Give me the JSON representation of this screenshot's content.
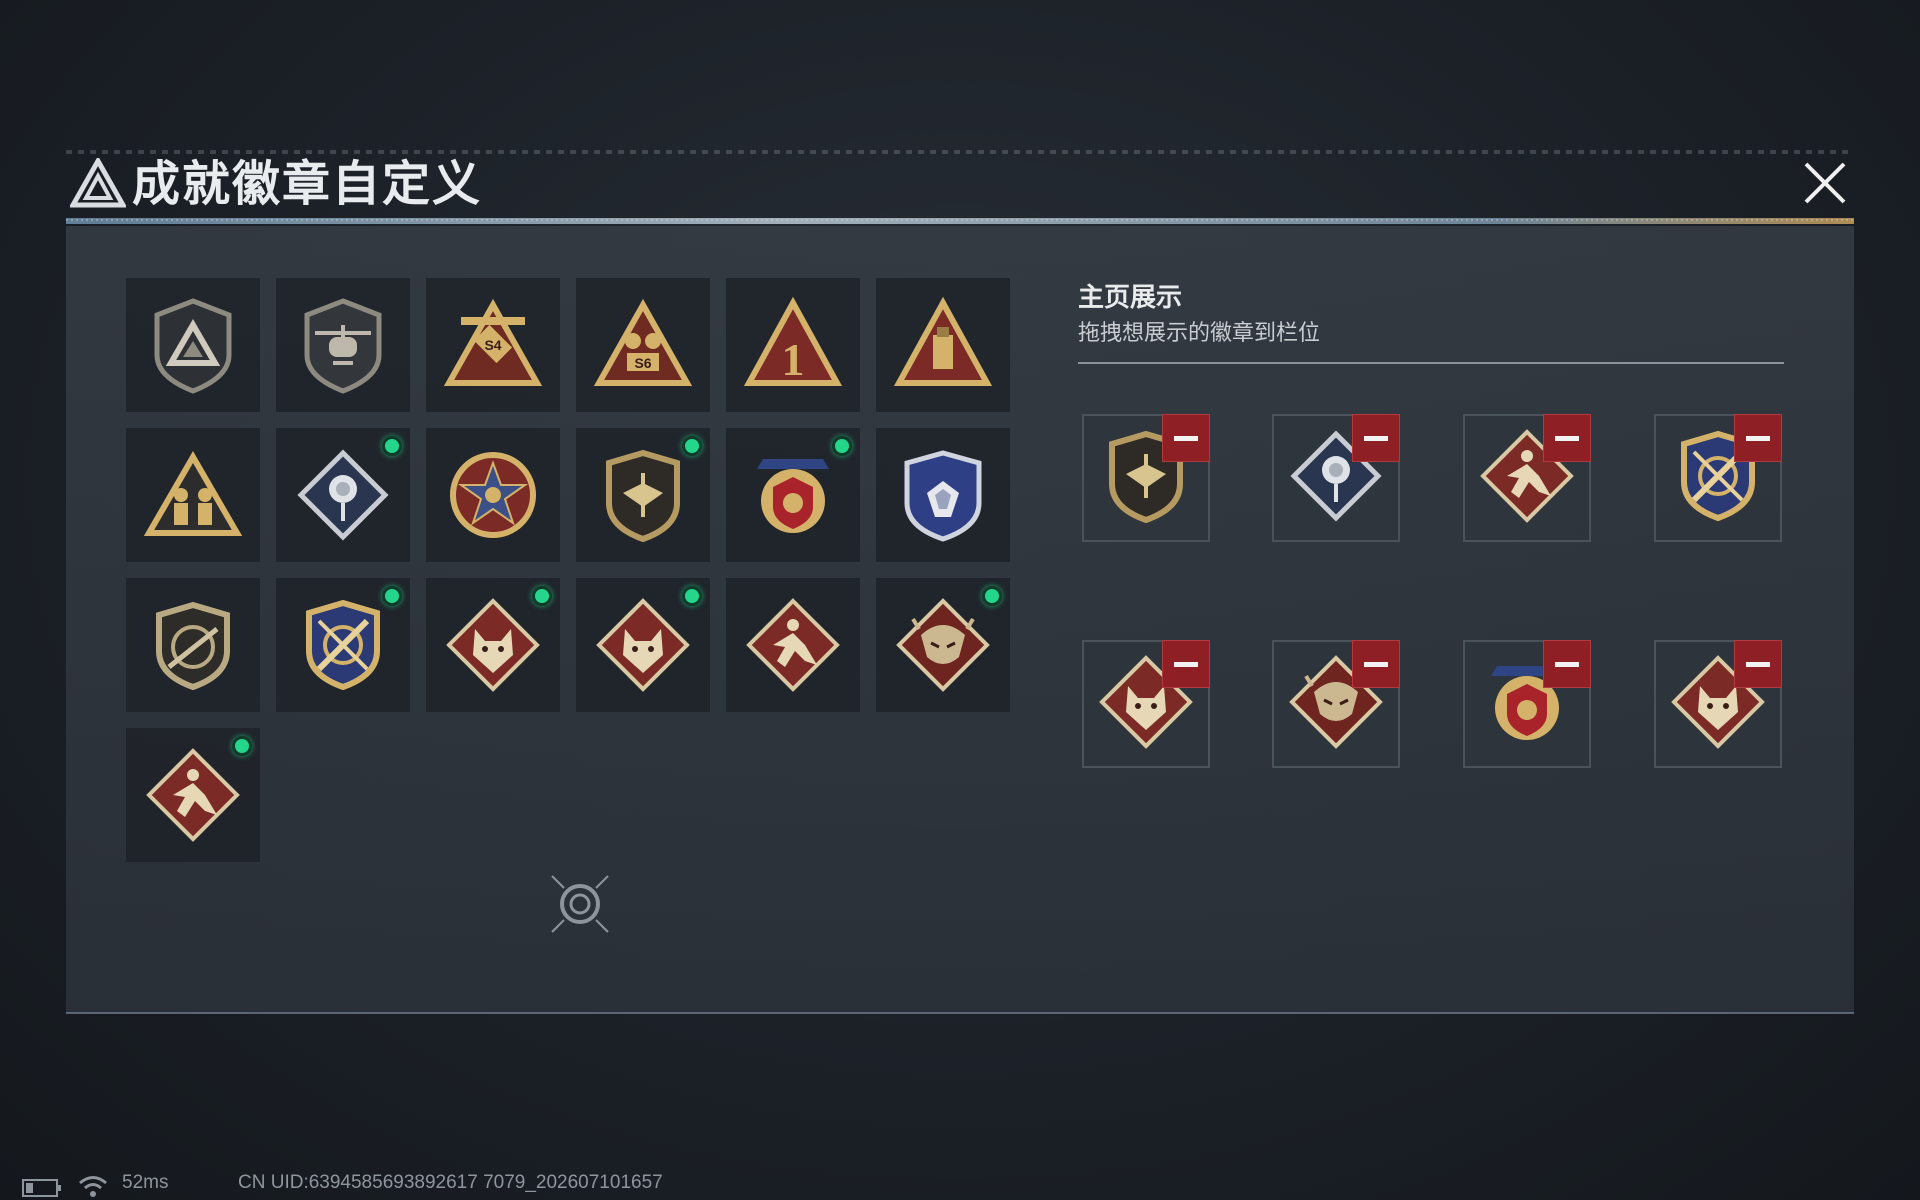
{
  "window": {
    "title": "成就徽章自定义",
    "close_icon": "close-icon"
  },
  "grid": {
    "badges": [
      {
        "icon": "triangle-shield-badge",
        "new": false
      },
      {
        "icon": "helicopter-shield-badge",
        "new": false
      },
      {
        "icon": "s4-triangle-badge",
        "new": false,
        "text": "S4"
      },
      {
        "icon": "s6-triangle-badge",
        "new": false,
        "text": "S6"
      },
      {
        "icon": "number-one-triangle-badge",
        "new": false,
        "text": "1"
      },
      {
        "icon": "usb-triangle-badge",
        "new": false
      },
      {
        "icon": "soldiers-triangle-badge",
        "new": false
      },
      {
        "icon": "rose-diamond-badge",
        "new": true
      },
      {
        "icon": "star-medal-badge",
        "new": false
      },
      {
        "icon": "bird-shield-badge",
        "new": true
      },
      {
        "icon": "laurel-star-badge",
        "new": true
      },
      {
        "icon": "diamond-blue-shield-badge",
        "new": false
      },
      {
        "icon": "rifle-shield-badge",
        "new": false
      },
      {
        "icon": "crossed-target-badge",
        "new": true
      },
      {
        "icon": "wolf-diamond-badge",
        "new": true
      },
      {
        "icon": "wolf-diamond-badge",
        "new": true
      },
      {
        "icon": "runner-diamond-badge",
        "new": false
      },
      {
        "icon": "dragon-diamond-badge",
        "new": true
      },
      {
        "icon": "runner-diamond-badge",
        "new": true
      }
    ]
  },
  "display": {
    "title": "主页展示",
    "description": "拖拽想展示的徽章到栏位",
    "slots": [
      {
        "icon": "bird-shield-badge",
        "remove_icon": "minus-icon"
      },
      {
        "icon": "rose-diamond-badge",
        "remove_icon": "minus-icon"
      },
      {
        "icon": "runner-diamond-badge",
        "remove_icon": "minus-icon"
      },
      {
        "icon": "crossed-target-badge",
        "remove_icon": "minus-icon"
      },
      {
        "icon": "wolf-diamond-badge",
        "remove_icon": "minus-icon"
      },
      {
        "icon": "dragon-diamond-badge",
        "remove_icon": "minus-icon"
      },
      {
        "icon": "laurel-star-badge",
        "remove_icon": "minus-icon"
      },
      {
        "icon": "wolf-diamond-badge",
        "remove_icon": "minus-icon"
      }
    ]
  },
  "footer": {
    "battery_icon": "battery-icon",
    "wifi_icon": "wifi-icon",
    "ping": "52ms",
    "uid": "CN UID:6394585693892617 7079_202607101657"
  },
  "colors": {
    "new_dot": "#24d68c",
    "remove_button": "#8e1f24",
    "gold": "#d4b26a",
    "maroon": "#7b2a25"
  }
}
